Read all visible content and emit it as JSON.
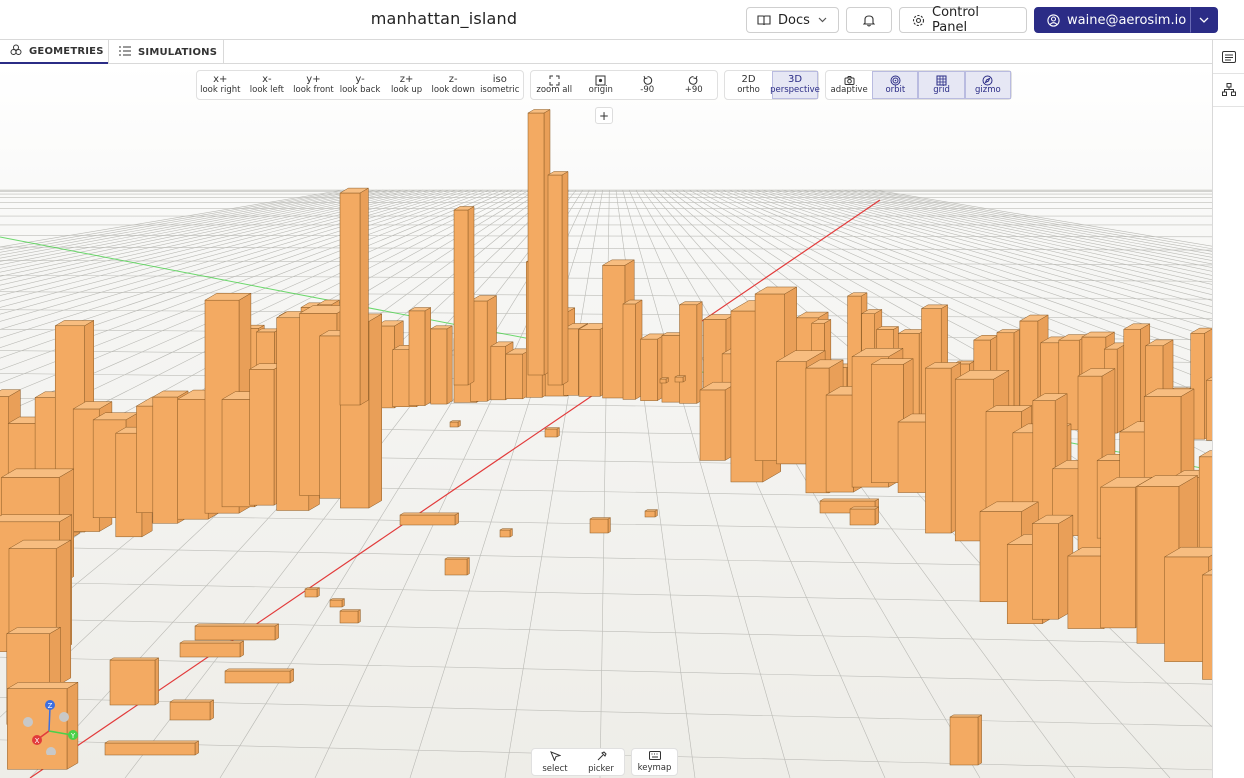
{
  "header": {
    "title": "manhattan_island",
    "docs_label": "Docs",
    "control_panel_label": "Control Panel",
    "user_email": "waine@aerosim.io"
  },
  "tabs": [
    {
      "label": "GEOMETRIES",
      "icon": "geometries-icon",
      "active": true
    },
    {
      "label": "SIMULATIONS",
      "icon": "list-icon",
      "active": false
    }
  ],
  "toolbar": {
    "view_buttons": [
      {
        "top": "x+",
        "label": "look right"
      },
      {
        "top": "x-",
        "label": "look left"
      },
      {
        "top": "y+",
        "label": "look front"
      },
      {
        "top": "y-",
        "label": "look back"
      },
      {
        "top": "z+",
        "label": "look up"
      },
      {
        "top": "z-",
        "label": "look down"
      },
      {
        "top": "iso",
        "label": "isometric"
      }
    ],
    "nav_buttons": [
      {
        "icon": "zoom-all-icon",
        "label": "zoom all"
      },
      {
        "icon": "origin-icon",
        "label": "origin"
      },
      {
        "icon": "rotate-ccw-icon",
        "label": "-90"
      },
      {
        "icon": "rotate-cw-icon",
        "label": "+90"
      }
    ],
    "projection_buttons": [
      {
        "top": "2D",
        "label": "ortho",
        "active": false
      },
      {
        "top": "3D",
        "label": "perspective",
        "active": true
      }
    ],
    "display_buttons": [
      {
        "icon": "camera-icon",
        "label": "adaptive",
        "active": false
      },
      {
        "icon": "orbit-icon",
        "label": "orbit",
        "active": true
      },
      {
        "icon": "grid-icon",
        "label": "grid",
        "active": true
      },
      {
        "icon": "gizmo-icon",
        "label": "gizmo",
        "active": true
      }
    ],
    "add_label": "+"
  },
  "bottom_tools": [
    {
      "icon": "select-icon",
      "label": "select"
    },
    {
      "icon": "picker-icon",
      "label": "picker"
    },
    {
      "icon": "keymap-icon",
      "label": "keymap"
    }
  ],
  "gizmo": {
    "x_label": "X",
    "y_label": "Y",
    "z_label": "Z"
  },
  "colors": {
    "brand": "#2b2c86",
    "building": "#f3aa62",
    "building_edge": "#8a5a25",
    "ground": "#efeee9",
    "x_axis": "#e23b3b",
    "y_axis": "#49d14a",
    "z_axis": "#3d6fe0"
  }
}
